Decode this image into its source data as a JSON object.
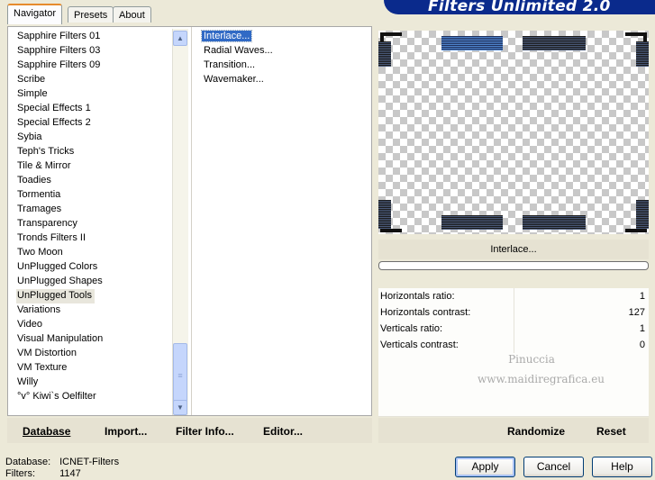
{
  "tabs": [
    "Navigator",
    "Presets",
    "About"
  ],
  "title": "Filters Unlimited 2.0",
  "categories": [
    "Sapphire Filters 01",
    "Sapphire Filters 03",
    "Sapphire Filters 09",
    "Scribe",
    "Simple",
    "Special Effects 1",
    "Special Effects 2",
    "Sybia",
    "Teph's Tricks",
    "Tile & Mirror",
    "Toadies",
    "Tormentia",
    "Tramages",
    "Transparency",
    "Tronds Filters II",
    "Two Moon",
    "UnPlugged Colors",
    "UnPlugged Shapes",
    "UnPlugged Tools",
    "Variations",
    "Video",
    "Visual Manipulation",
    "VM Distortion",
    "VM Texture",
    "Willy",
    "°v° Kiwi`s Oelfilter"
  ],
  "selected_category": "UnPlugged Tools",
  "filters": [
    "Interlace...",
    "Radial Waves...",
    "Transition...",
    "Wavemaker..."
  ],
  "selected_filter": "Interlace...",
  "left_buttons": {
    "database": "Database",
    "import": "Import...",
    "filter_info": "Filter Info...",
    "editor": "Editor..."
  },
  "preview": {
    "filter_name": "Interlace...",
    "progress": 0
  },
  "params": [
    {
      "label": "Horizontals ratio:",
      "value": "1"
    },
    {
      "label": "Horizontals contrast:",
      "value": "127"
    },
    {
      "label": "Verticals ratio:",
      "value": "1"
    },
    {
      "label": "Verticals contrast:",
      "value": "0"
    }
  ],
  "watermark": {
    "line1": "Pinuccia",
    "line2": "www.maidiregrafica.eu"
  },
  "right_buttons": {
    "randomize": "Randomize",
    "reset": "Reset"
  },
  "footer": {
    "database_label": "Database:",
    "database_value": "ICNET-Filters",
    "filters_label": "Filters:",
    "filters_value": "1147"
  },
  "dialog_buttons": {
    "apply": "Apply",
    "cancel": "Cancel",
    "help": "Help"
  },
  "colors": {
    "title_banner": "#0A2A8C",
    "selection": "#316AC5",
    "background": "#ECE9D8"
  }
}
